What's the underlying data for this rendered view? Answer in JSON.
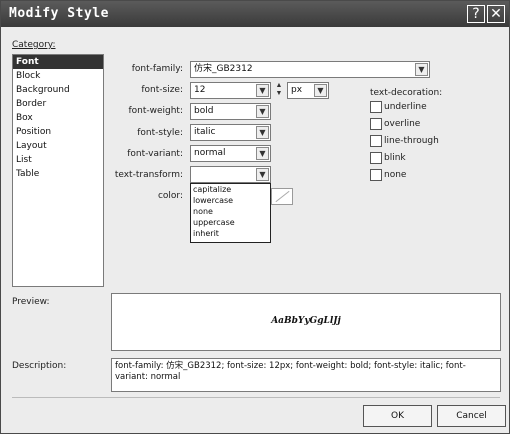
{
  "window": {
    "title": "Modify Style",
    "help_glyph": "?",
    "close_glyph": "✕"
  },
  "category": {
    "label": "Category:",
    "items": [
      "Font",
      "Block",
      "Background",
      "Border",
      "Box",
      "Position",
      "Layout",
      "List",
      "Table"
    ],
    "selected": "Font"
  },
  "font": {
    "family_label": "font-family:",
    "family_value": "仿宋_GB2312",
    "size_label": "font-size:",
    "size_value": "12",
    "size_unit": "px",
    "weight_label": "font-weight:",
    "weight_value": "bold",
    "style_label": "font-style:",
    "style_value": "italic",
    "variant_label": "font-variant:",
    "variant_value": "normal",
    "transform_label": "text-transform:",
    "transform_value": "",
    "transform_options": [
      "capitalize",
      "lowercase",
      "none",
      "uppercase",
      "inherit"
    ],
    "color_label": "color:"
  },
  "decoration": {
    "label": "text-decoration:",
    "options": [
      "underline",
      "overline",
      "line-through",
      "blink",
      "none"
    ]
  },
  "preview": {
    "label": "Preview:",
    "sample": "AaBbYyGgLlJj"
  },
  "description": {
    "label": "Description:",
    "text": "font-family: 仿宋_GB2312; font-size: 12px; font-weight: bold; font-style: italic; font-variant: normal"
  },
  "buttons": {
    "ok": "OK",
    "cancel": "Cancel"
  },
  "icons": {
    "dropdown_arrow": "chevron-down-icon",
    "spin_up": "▲",
    "spin_down": "▼"
  }
}
